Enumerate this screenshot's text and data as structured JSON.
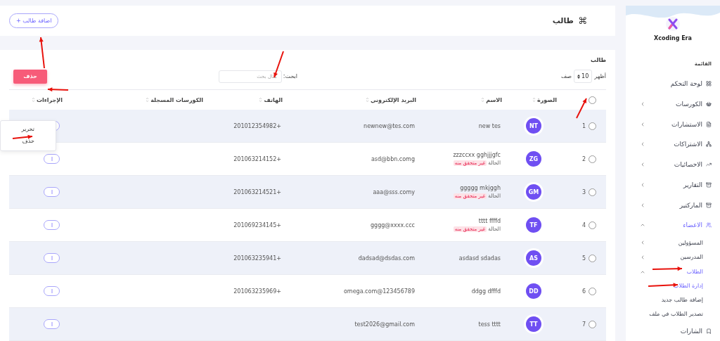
{
  "sidebar": {
    "brand": "Xcoding Era",
    "section": "القائمة",
    "items": [
      {
        "label": "لوحة التحكم",
        "active": false
      },
      {
        "label": "الكورسات",
        "active": false,
        "expanded": false
      },
      {
        "label": "الاستشارات",
        "active": false,
        "expanded": false
      },
      {
        "label": "الاشتراكات",
        "active": false,
        "expanded": false
      },
      {
        "label": "الاحصائيات",
        "active": false,
        "expanded": false
      },
      {
        "label": "التقارير",
        "active": false,
        "expanded": false
      },
      {
        "label": "الماركتير",
        "active": false,
        "expanded": false
      },
      {
        "label": "الاعضاء",
        "active": true,
        "expanded": true,
        "children": [
          {
            "label": "المسؤولين",
            "active": false,
            "expanded": false
          },
          {
            "label": "المدرسين",
            "active": false,
            "expanded": false
          },
          {
            "label": "الطلاب",
            "active": true,
            "expanded": true,
            "children": [
              {
                "label": "إدارة الطلاب",
                "active": true
              },
              {
                "label": "إضافة طالب جديد",
                "active": false
              },
              {
                "label": "تصدير الطلاب في ملف",
                "active": false
              }
            ]
          }
        ]
      },
      {
        "label": "الشارات",
        "active": false
      }
    ]
  },
  "header": {
    "icon": "⌘",
    "title": "طالب",
    "add_button": "اضافة طالب +"
  },
  "card": {
    "title": "طالب",
    "show_label": "أظهر",
    "page_size": "10",
    "rows_label": "صف",
    "search_label": "ابحث:",
    "search_placeholder": "مثال بحث",
    "delete_button": "حذف"
  },
  "table": {
    "select_all_checked": false,
    "columns": [
      "الصورة",
      "الاسم",
      "البريد الإلكتروني",
      "الهاتف",
      "الكورسات المسجلة",
      "الإجراءات"
    ],
    "rows": [
      {
        "index": "1",
        "checked": false,
        "initials": "NT",
        "name": "new tes",
        "email": "newnew@tes.com",
        "phone": "201012354982+",
        "menu": [
          "تحرير",
          "حذف"
        ]
      },
      {
        "index": "2",
        "checked": false,
        "initials": "ZG",
        "name": "zzzccxx gghjjjgfc",
        "status_label": "الحالة",
        "status": "غير متحقق منه",
        "email": "asd@bbn.comg",
        "phone": "201063214152+"
      },
      {
        "index": "3",
        "checked": false,
        "initials": "GM",
        "name": "ggggg mkjggh",
        "status_label": "الحالة",
        "status": "غير متحقق منه",
        "email": "aaa@sss.comy",
        "phone": "201063214521+"
      },
      {
        "index": "4",
        "checked": false,
        "initials": "TF",
        "name": "tttt ffffd",
        "status_label": "الحالة",
        "status": "غير متحقق منه",
        "email": "gggg@xxxx.ccc",
        "phone": "201069234145+"
      },
      {
        "index": "5",
        "checked": false,
        "initials": "AS",
        "name": "asdasd sdadas",
        "email": "dadsad@dsdas.com",
        "phone": "201063235941+"
      },
      {
        "index": "6",
        "checked": false,
        "initials": "DD",
        "name": "ddgg dfffd",
        "email": "omega.com@123456789",
        "phone": "201063235969+"
      },
      {
        "index": "7",
        "checked": false,
        "initials": "TT",
        "name": "tess tttt",
        "email": "test2026@gmail.com"
      }
    ]
  }
}
